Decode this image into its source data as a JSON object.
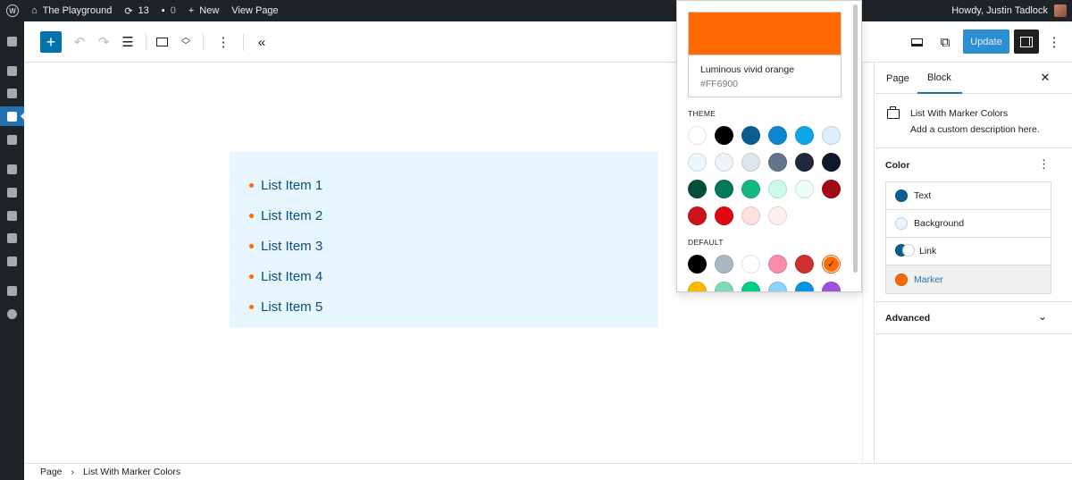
{
  "admin_bar": {
    "site_name": "The Playground",
    "updates_count": "13",
    "comments_count": "0",
    "new_label": "New",
    "view_page_label": "View Page",
    "greeting": "Howdy, Justin Tadlock"
  },
  "sidebar": {
    "tabs": [
      "Page",
      "Block"
    ],
    "block_title": "List With Marker Colors",
    "block_description": "Add a custom description here.",
    "color_title": "Color",
    "color_items": [
      {
        "label": "Text",
        "color": "#0b5f8f"
      },
      {
        "label": "Background",
        "color": "#e7f5fe"
      },
      {
        "label": "Link",
        "color_a": "#0b5f8f",
        "color_b": "#ffffff"
      },
      {
        "label": "Marker",
        "color": "#ff6900"
      }
    ],
    "advanced_title": "Advanced"
  },
  "toolbar": {
    "update_label": "Update"
  },
  "list": {
    "items": [
      "List Item 1",
      "List Item 2",
      "List Item 3",
      "List Item 4",
      "List Item 5"
    ],
    "marker_color": "#ff6900",
    "text_color": "#0d4e77",
    "background_color": "#e7f5fe"
  },
  "footer": {
    "crumbs": [
      "Page",
      "List With Marker Colors"
    ]
  },
  "popover": {
    "selected_color": "#ff6900",
    "color_name": "Luminous vivid orange",
    "color_hex": "#FF6900",
    "theme_label": "THEME",
    "default_label": "DEFAULT",
    "theme_colors": [
      "#ffffff",
      "#000000",
      "#0b5f8f",
      "#0d86d1",
      "#0ea5e9",
      "#dbeffc",
      "#edf8fe",
      "#eef3fa",
      "#dde5ee",
      "#64748b",
      "#1e293b",
      "#0f172a",
      "#064e3b",
      "#047857",
      "#10b981",
      "#ccfbeb",
      "#ecfdf7",
      "#a30a17",
      "#c9161e",
      "#e00713",
      "#fde1e1",
      "#fdf0ef"
    ],
    "default_colors": [
      "#000000",
      "#abb8c3",
      "#ffffff",
      "#f78da7",
      "#cf2e2e",
      "#ff6900",
      "#fcb900",
      "#7bdcb5",
      "#00d084",
      "#8ed1fc",
      "#0693e3",
      "#9b51e0"
    ],
    "selected_default_index": 5
  }
}
